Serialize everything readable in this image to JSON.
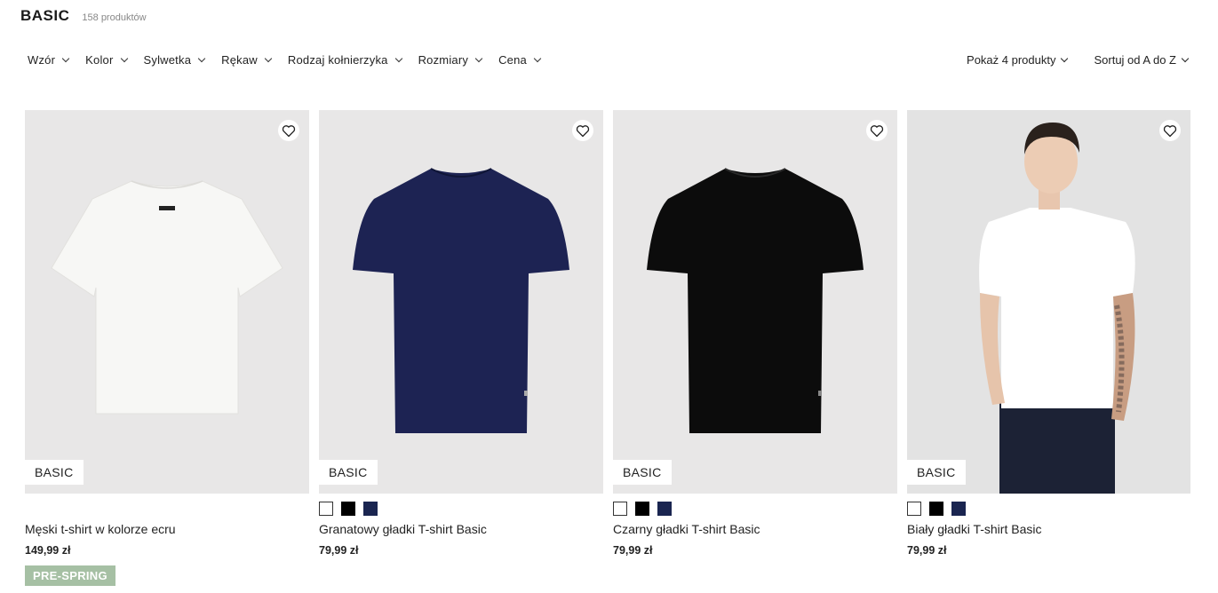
{
  "header": {
    "title": "BASIC",
    "count": "158 produktów"
  },
  "filters": [
    "Wzór",
    "Kolor",
    "Sylwetka",
    "Rękaw",
    "Rodzaj kołnierzyka",
    "Rozmiary",
    "Cena"
  ],
  "controls": {
    "show_label": "Pokaż 4 produkty",
    "sort_label": "Sortuj od A do Z"
  },
  "products": [
    {
      "name": "Męski t-shirt w kolorze ecru",
      "price": "149,99 zł",
      "badge": "BASIC",
      "tag": "PRE-SPRING",
      "image_color": "#f7f7f5"
    },
    {
      "name": "Granatowy gładki T-shirt Basic",
      "price": "79,99 zł",
      "badge": "BASIC",
      "swatches": [
        "white",
        "black",
        "navy"
      ],
      "image_color": "#1d2353"
    },
    {
      "name": "Czarny gładki T-shirt Basic",
      "price": "79,99 zł",
      "badge": "BASIC",
      "swatches": [
        "white",
        "black",
        "navy"
      ],
      "image_color": "#0c0c0c"
    },
    {
      "name": "Biały gładki T-shirt Basic",
      "price": "79,99 zł",
      "badge": "BASIC",
      "swatches": [
        "white",
        "black",
        "navy"
      ],
      "image_color": "#ffffff"
    }
  ],
  "colors": {
    "tag_bg": "#a6c0a4",
    "image_bg": "#e8e7e7",
    "navy": "#1a2550"
  }
}
